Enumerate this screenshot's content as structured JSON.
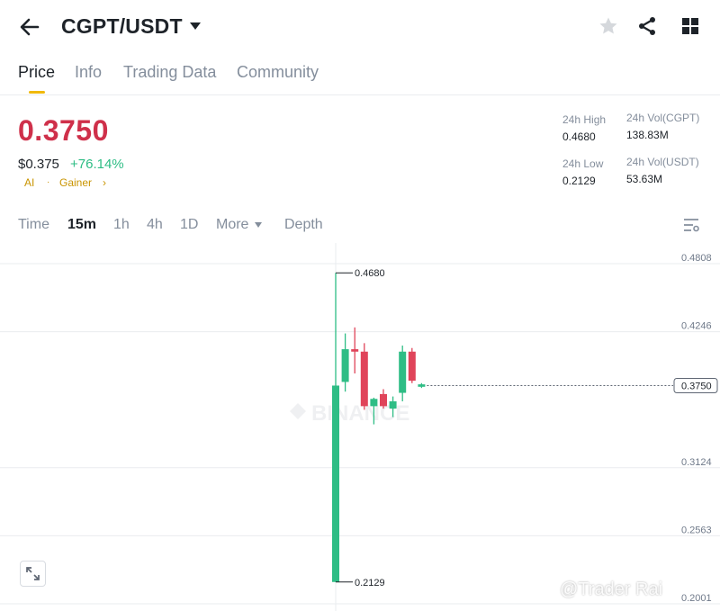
{
  "header": {
    "pair": "CGPT/USDT",
    "icons": [
      "back-arrow-icon",
      "caret-down-icon",
      "star-icon",
      "share-icon",
      "grid-icon"
    ]
  },
  "tabs": [
    {
      "label": "Price",
      "active": true
    },
    {
      "label": "Info"
    },
    {
      "label": "Trading Data"
    },
    {
      "label": "Community"
    }
  ],
  "price": {
    "last": "0.3750",
    "usd": "$0.375",
    "change": "+76.14%",
    "tags": [
      "AI",
      "Gainer"
    ]
  },
  "stats": {
    "high_label": "24h High",
    "high": "0.4680",
    "low_label": "24h Low",
    "low": "0.2129",
    "vol_base_label": "24h Vol(CGPT)",
    "vol_base": "138.83M",
    "vol_quote_label": "24h Vol(USDT)",
    "vol_quote": "53.63M"
  },
  "intervals": [
    {
      "label": "Time"
    },
    {
      "label": "15m",
      "active": true
    },
    {
      "label": "1h"
    },
    {
      "label": "4h"
    },
    {
      "label": "1D"
    },
    {
      "label": "More"
    },
    {
      "label": "Depth"
    }
  ],
  "watermark": "@Trader Rai",
  "colors": {
    "up": "#2ebd85",
    "down": "#e0445a",
    "price": "#cf304a",
    "accent": "#f0b90b"
  },
  "chart_data": {
    "type": "candlestick",
    "interval": "15m",
    "y_ticks": [
      0.4808,
      0.4246,
      0.3124,
      0.2563,
      0.2001
    ],
    "ylim": [
      0.2001,
      0.4808
    ],
    "high_marker": "0.4680",
    "low_marker": "0.2129",
    "last_price_label": "0.3750",
    "candles": [
      {
        "open": 0.2129,
        "high": 0.468,
        "low": 0.2129,
        "close": 0.375
      },
      {
        "open": 0.378,
        "high": 0.418,
        "low": 0.37,
        "close": 0.405
      },
      {
        "open": 0.405,
        "high": 0.423,
        "low": 0.385,
        "close": 0.403
      },
      {
        "open": 0.403,
        "high": 0.41,
        "low": 0.355,
        "close": 0.358
      },
      {
        "open": 0.358,
        "high": 0.365,
        "low": 0.343,
        "close": 0.364
      },
      {
        "open": 0.368,
        "high": 0.372,
        "low": 0.356,
        "close": 0.358
      },
      {
        "open": 0.356,
        "high": 0.366,
        "low": 0.349,
        "close": 0.362
      },
      {
        "open": 0.369,
        "high": 0.408,
        "low": 0.362,
        "close": 0.403
      },
      {
        "open": 0.403,
        "high": 0.406,
        "low": 0.377,
        "close": 0.379
      },
      {
        "open": 0.374,
        "high": 0.377,
        "low": 0.373,
        "close": 0.376
      }
    ]
  }
}
